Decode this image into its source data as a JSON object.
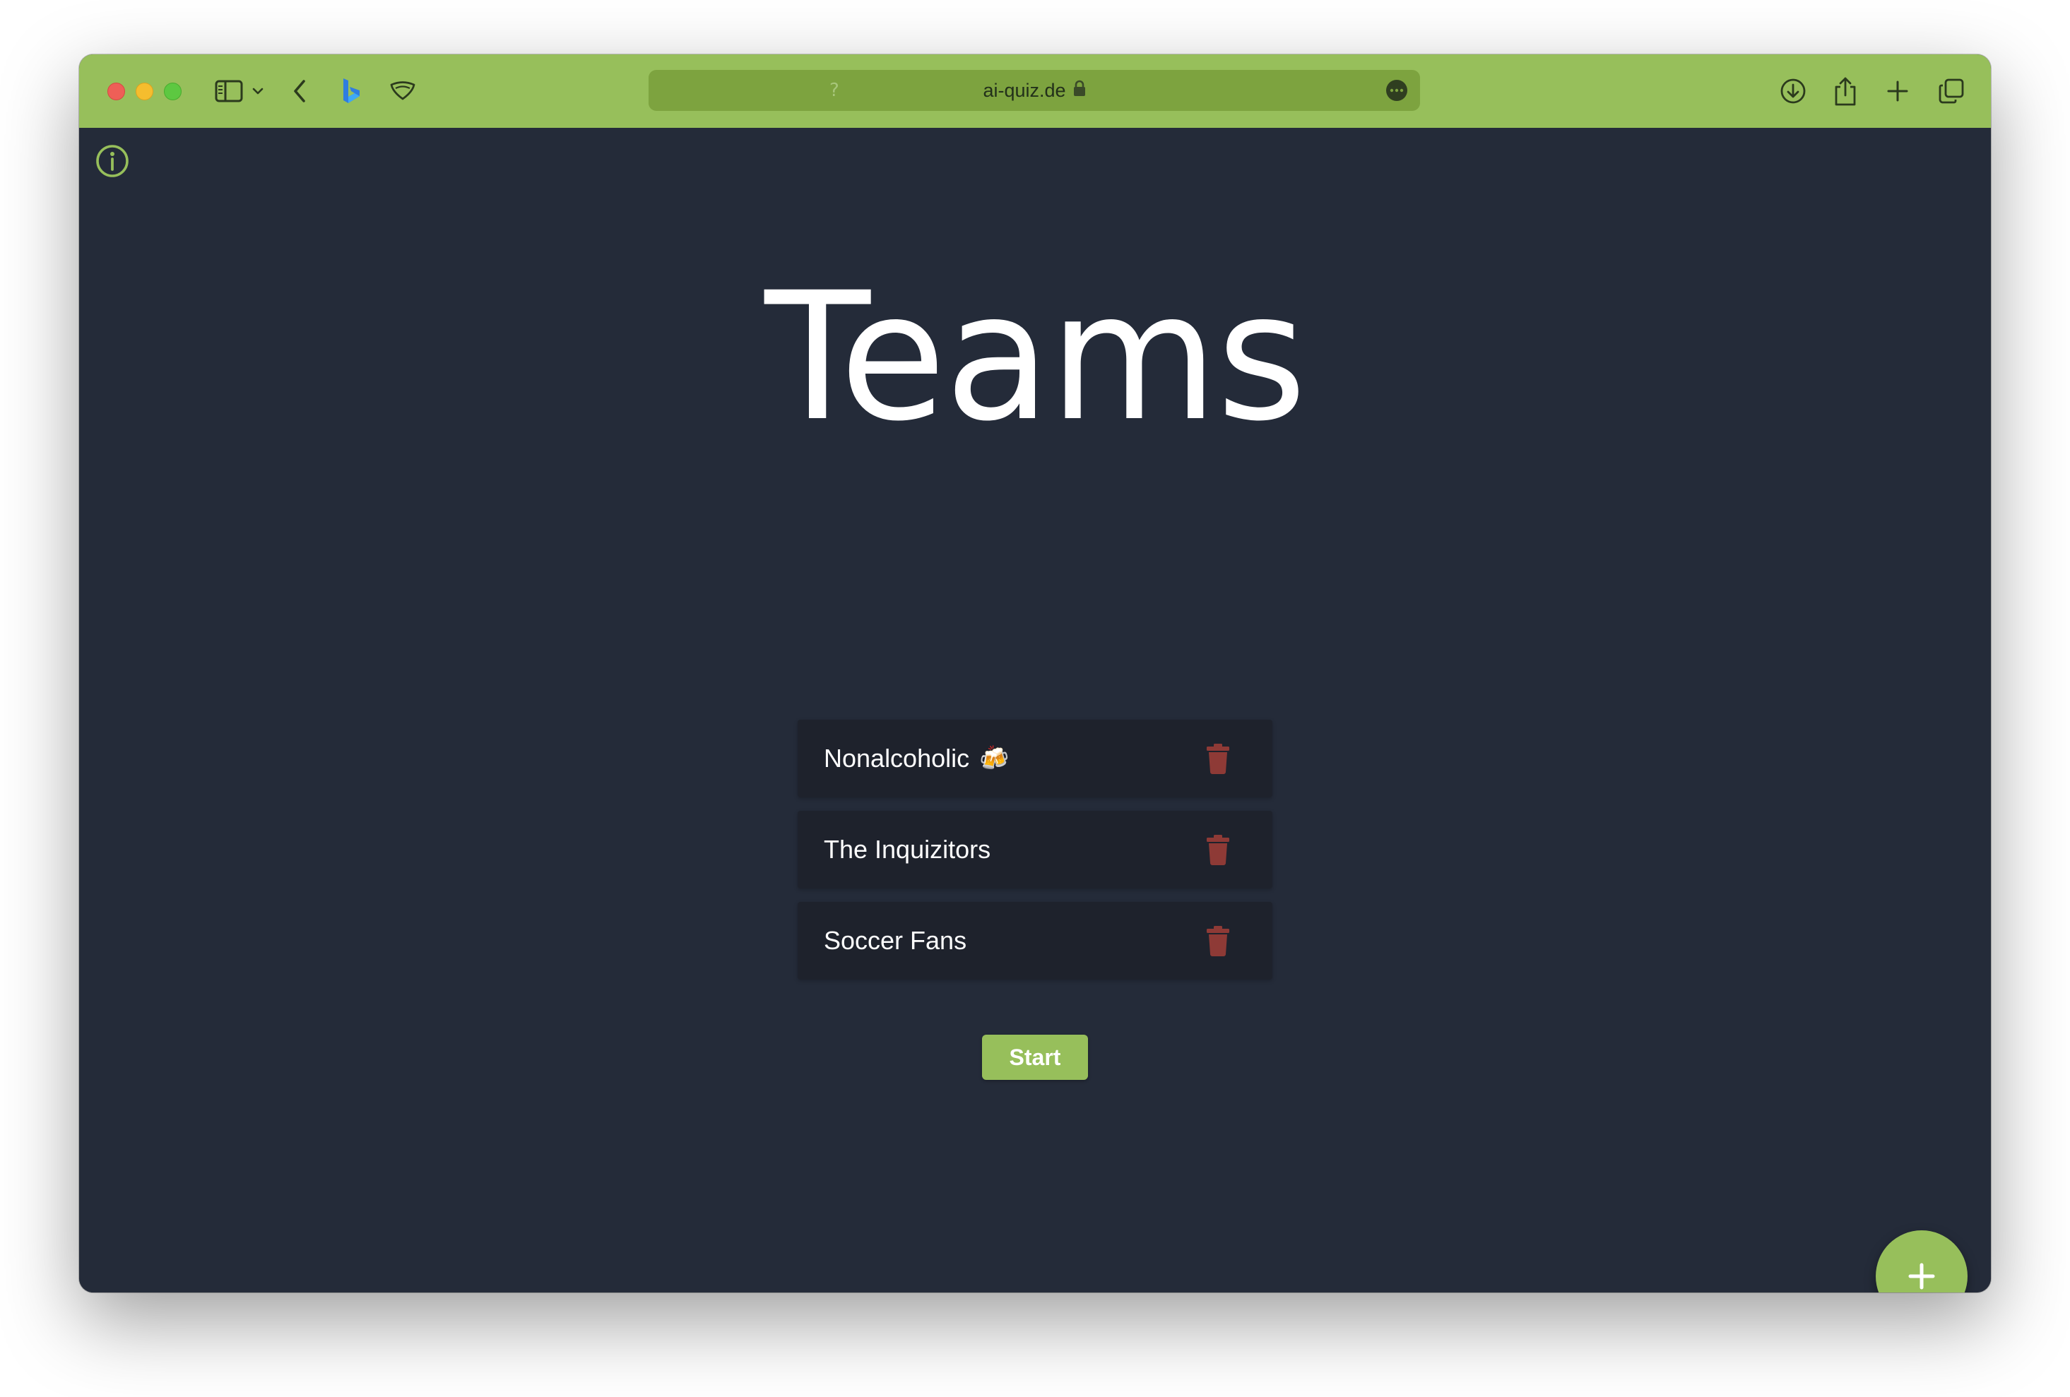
{
  "browser": {
    "url": "ai-quiz.de",
    "toolbar_color": "#97bf5b",
    "icons": [
      "sidebar-icon",
      "chevron-down-icon",
      "back-icon",
      "bing-icon",
      "shield-icon",
      "lock-icon",
      "more-icon",
      "download-icon",
      "share-icon",
      "plus-icon",
      "tabs-icon"
    ]
  },
  "page": {
    "title": "Teams",
    "teams": [
      {
        "name": "Nonalcoholic",
        "emoji": "🍻"
      },
      {
        "name": "The Inquizitors",
        "emoji": ""
      },
      {
        "name": "Soccer Fans",
        "emoji": ""
      }
    ],
    "start_label": "Start",
    "add_label": "+",
    "accent_color": "#97bf5b",
    "background_color": "#242b39",
    "delete_color": "#8e3a36"
  }
}
